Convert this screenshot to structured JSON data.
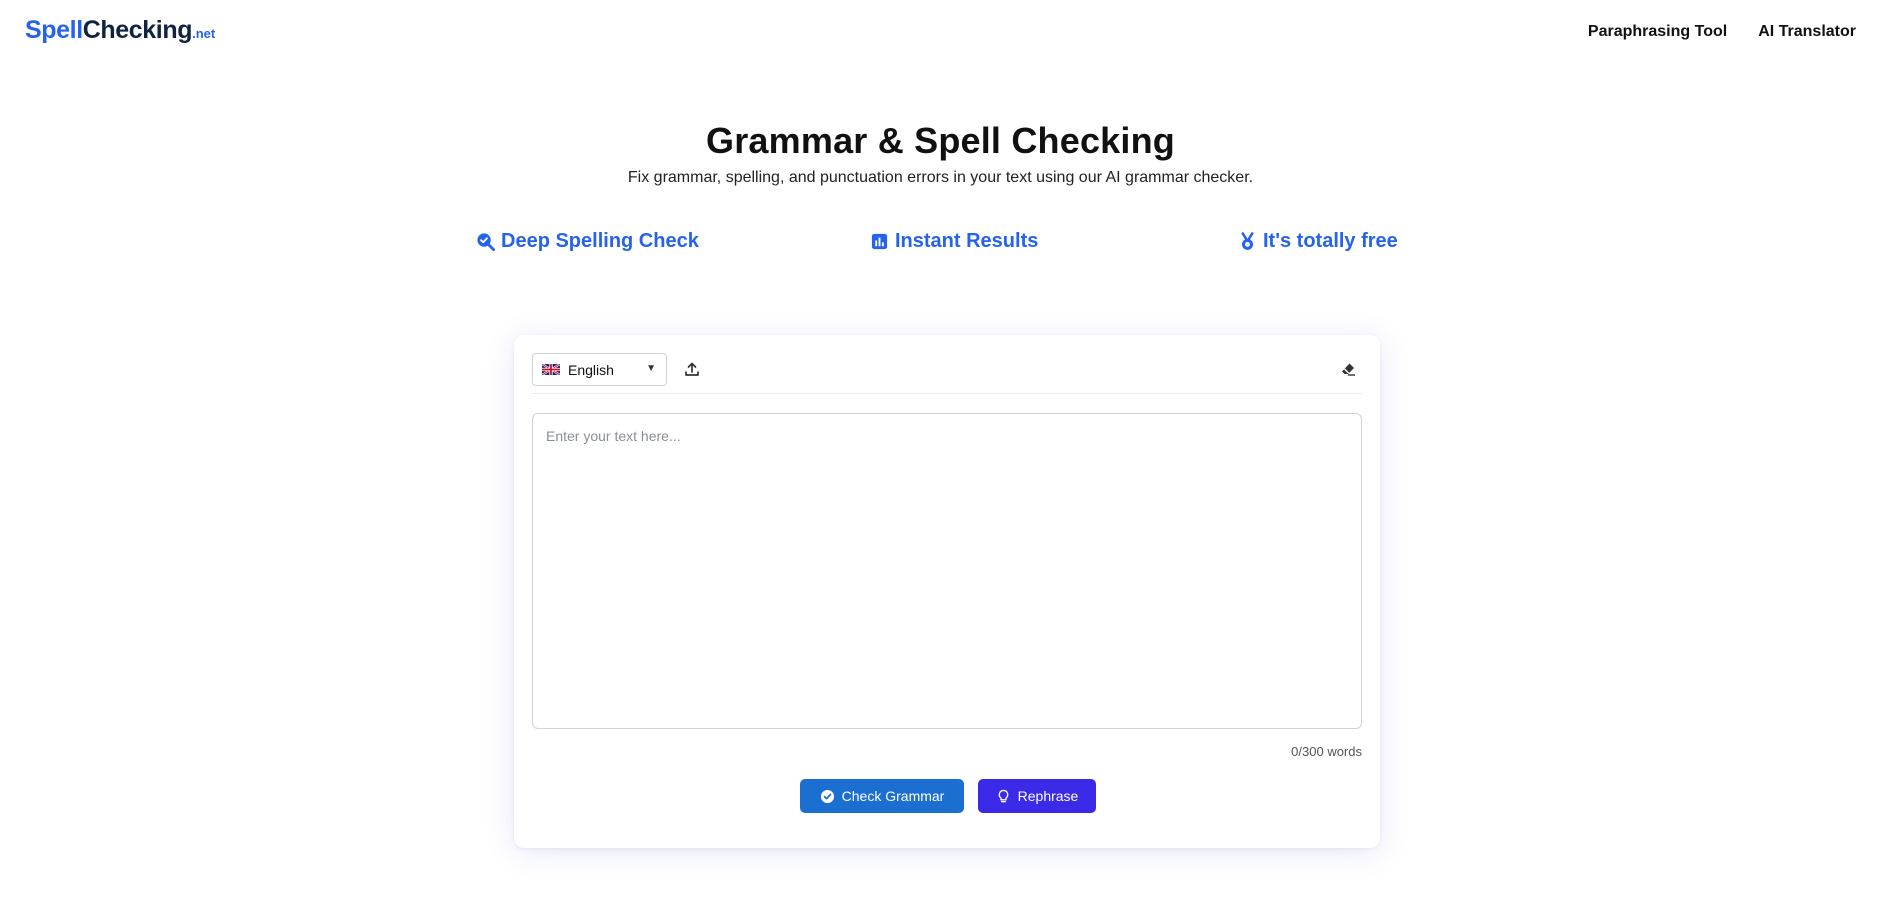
{
  "header": {
    "logo": {
      "part1": "Spell",
      "part2": "Checking",
      "part3": ".net"
    },
    "nav": [
      {
        "label": "Paraphrasing Tool"
      },
      {
        "label": "AI Translator"
      }
    ]
  },
  "hero": {
    "title": "Grammar & Spell Checking",
    "subtitle": "Fix grammar, spelling, and punctuation errors in your text using our AI grammar checker."
  },
  "features": [
    {
      "label": "Deep Spelling Check",
      "icon": "magnifier-check-icon"
    },
    {
      "label": "Instant Results",
      "icon": "chart-box-icon"
    },
    {
      "label": "It's totally free",
      "icon": "medal-icon"
    }
  ],
  "editor": {
    "language": {
      "selected": "English",
      "flag_icon": "uk-flag-icon",
      "caret": "▼"
    },
    "upload_icon": "upload-icon",
    "clear_icon": "eraser-icon",
    "placeholder": "Enter your text here...",
    "value": "",
    "word_count": "0/300 words",
    "buttons": {
      "check": {
        "label": "Check Grammar",
        "icon": "check-circle-icon"
      },
      "rephrase": {
        "label": "Rephrase",
        "icon": "lightbulb-icon"
      }
    }
  },
  "colors": {
    "brand": "#2563eb",
    "logo_dark": "#10243f",
    "check_button": "#1a6fd1",
    "rephrase_button": "#3b2be8",
    "text": "#111111"
  }
}
